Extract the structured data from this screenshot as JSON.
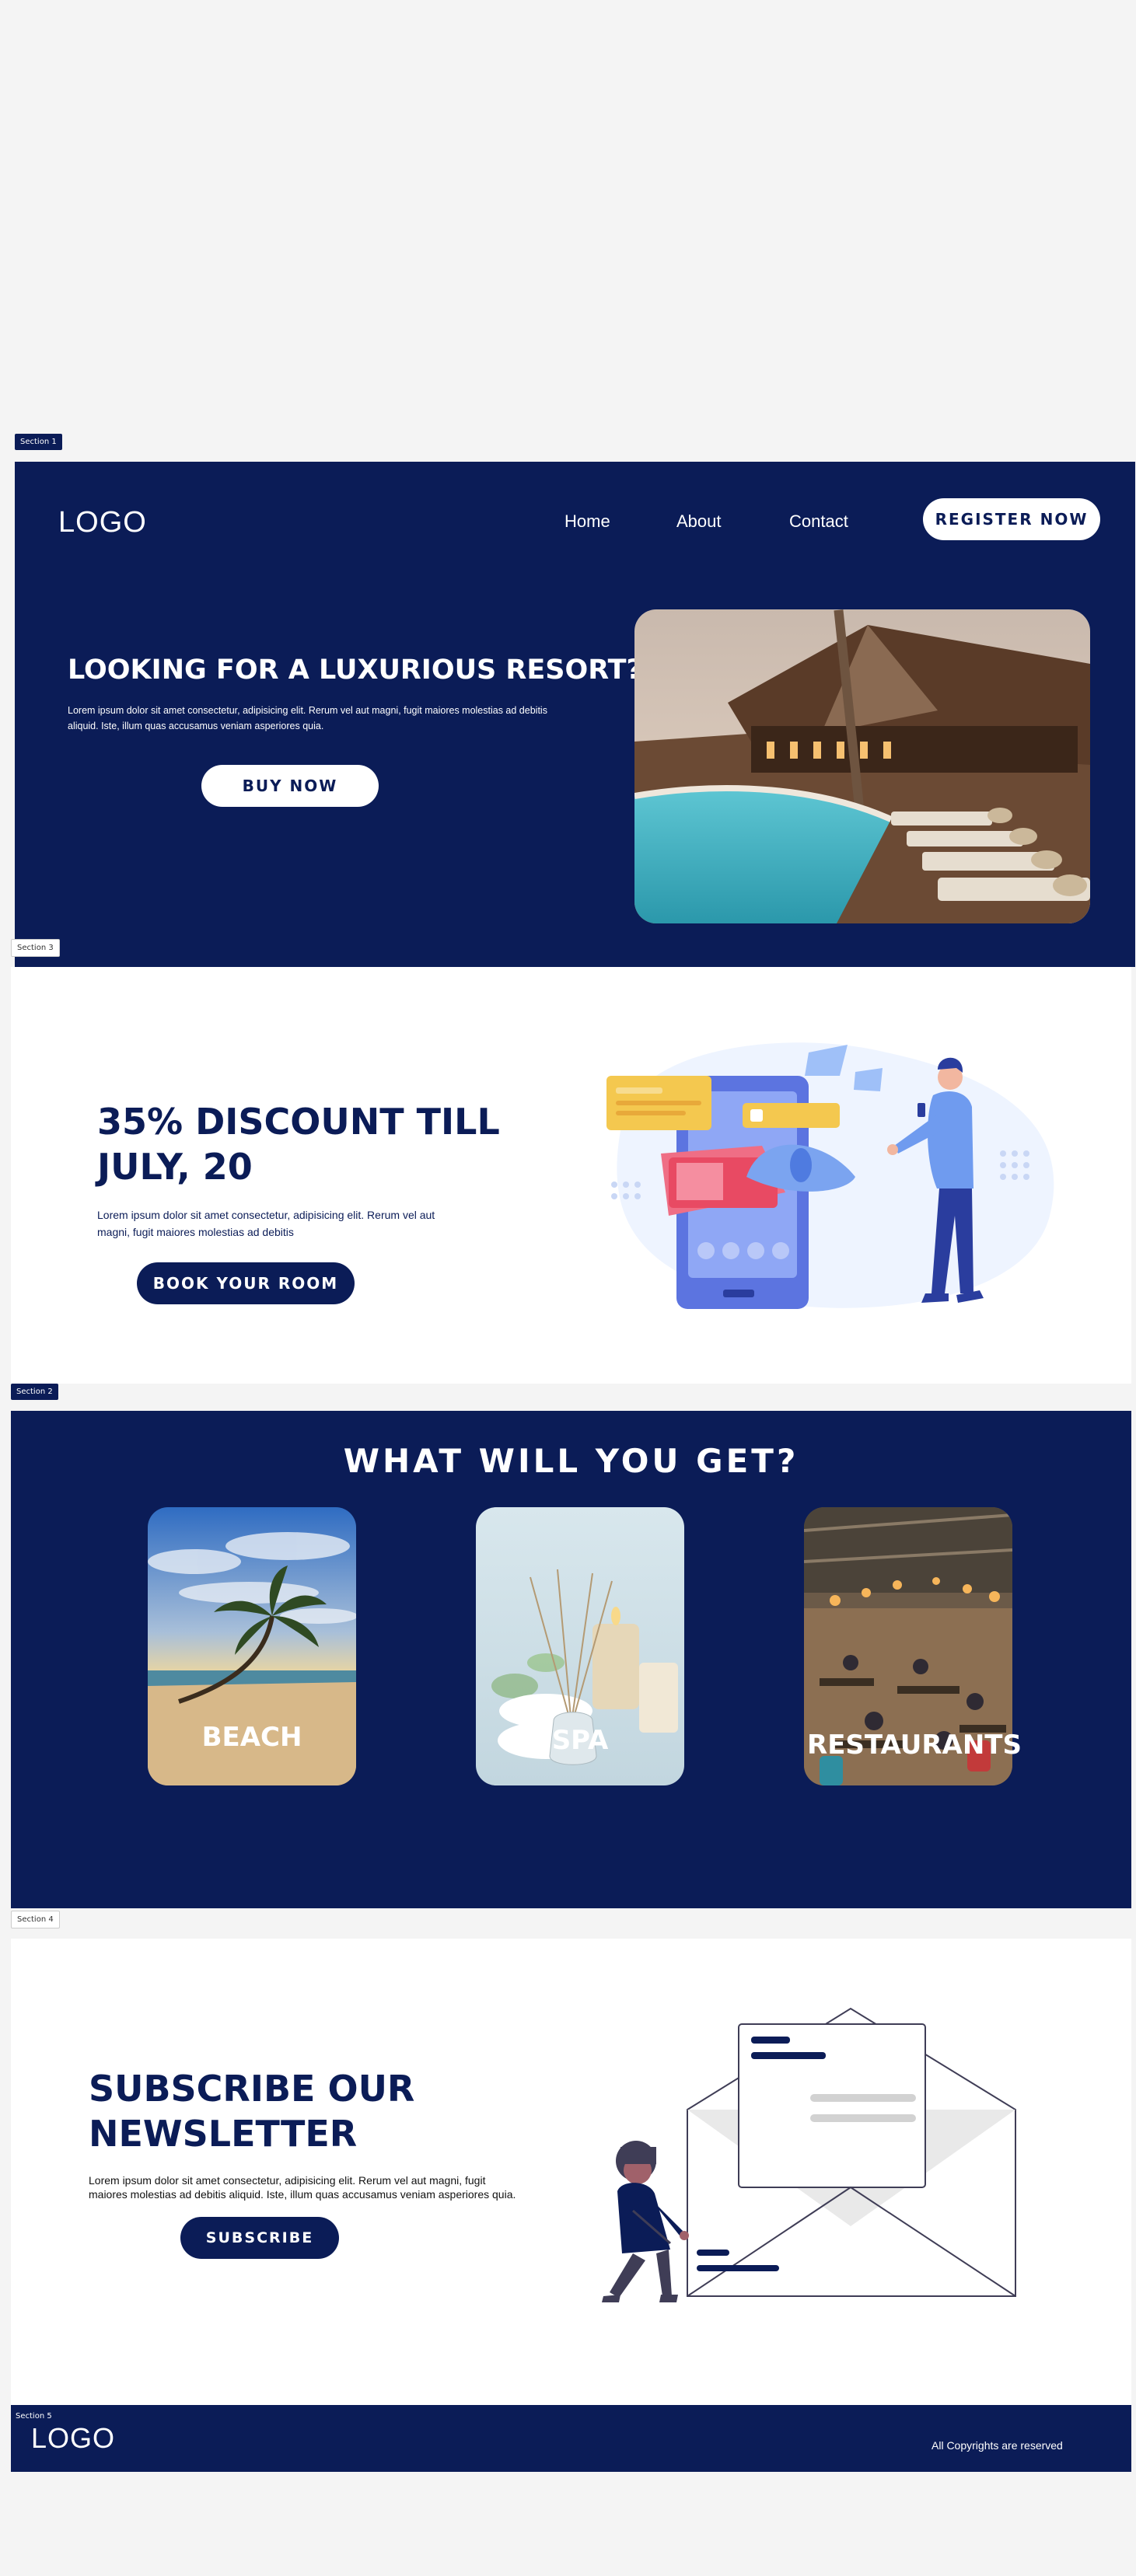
{
  "section_tags": {
    "s1": "Section 1",
    "s3": "Section 3",
    "s2": "Section 2",
    "s4": "Section 4",
    "s5": "Section 5"
  },
  "header": {
    "logo": "LOGO",
    "nav": [
      "Home",
      "About",
      "Contact"
    ],
    "register_label": "REGISTER NOW"
  },
  "hero": {
    "title": "LOOKING FOR A LUXURIOUS RESORT?",
    "body": "Lorem ipsum dolor sit amet consectetur, adipisicing elit. Rerum vel aut magni, fugit maiores molestias ad debitis aliquid. Iste, illum quas accusamus veniam asperiores quia.",
    "cta": "BUY NOW",
    "image_alt": "resort-pool-image"
  },
  "discount": {
    "title_line1": "35% DISCOUNT TILL",
    "title_line2": "JULY, 20",
    "body": "Lorem ipsum dolor sit amet consectetur, adipisicing elit. Rerum vel aut magni, fugit maiores molestias ad debitis",
    "cta": "BOOK YOUR ROOM"
  },
  "features": {
    "title": "WHAT WILL YOU GET?",
    "items": [
      {
        "label": "BEACH"
      },
      {
        "label": "SPA"
      },
      {
        "label": "RESTAURANTS"
      }
    ]
  },
  "newsletter": {
    "title_line1": "SUBSCRIBE OUR",
    "title_line2": "NEWSLETTER",
    "body": "Lorem ipsum dolor sit amet consectetur, adipisicing elit. Rerum vel aut magni, fugit maiores molestias ad debitis aliquid. Iste, illum quas accusamus veniam asperiores quia.",
    "cta": "SUBSCRIBE"
  },
  "footer": {
    "logo": "LOGO",
    "copyright": "All Copyrights are reserved"
  },
  "colors": {
    "navy": "#0b1c57",
    "page_bg": "#f4f4f4",
    "white": "#ffffff"
  }
}
